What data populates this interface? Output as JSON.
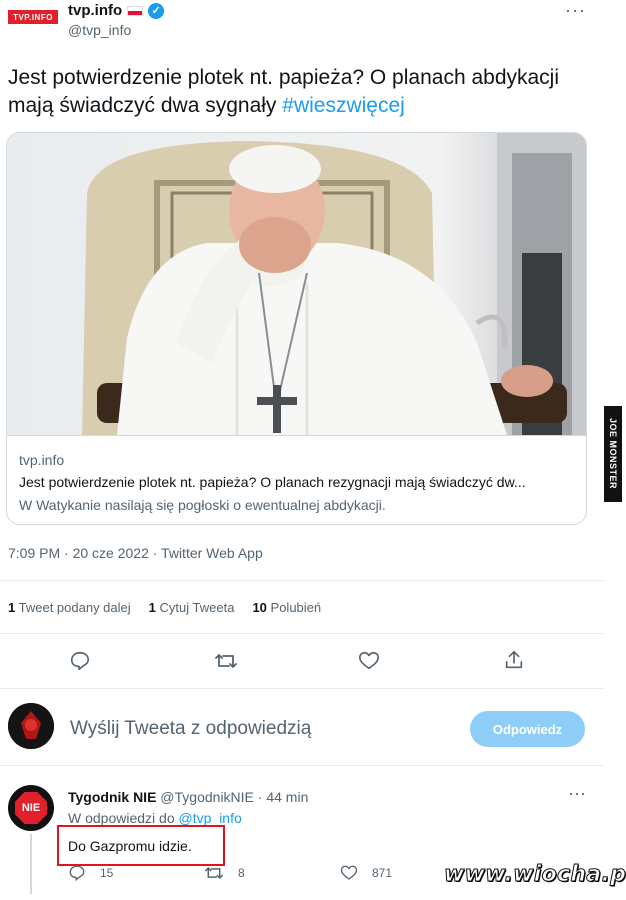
{
  "tweet": {
    "logo_text": "TVP.INFO",
    "author_name": "tvp.info",
    "author_handle": "@tvp_info",
    "more_label": "···",
    "text": "Jest potwierdzenie plotek nt. papieża? O planach abdykacji mają świadczyć dwa sygnały ",
    "hashtag": "#wieszwięcej",
    "card": {
      "domain": "tvp.info",
      "title": "Jest potwierdzenie plotek nt. papieża? O planach rezygnacji mają świadczyć dw...",
      "description": "W Watykanie nasilają się pogłoski o ewentualnej abdykacji."
    },
    "timestamp": "7:09 PM · 20 cze 2022 · Twitter Web App",
    "stats": {
      "retweets_count": "1",
      "retweets_label": "Tweet podany dalej",
      "quotes_count": "1",
      "quotes_label": "Cytuj Tweeta",
      "likes_count": "10",
      "likes_label": "Polubień"
    }
  },
  "compose": {
    "placeholder": "Wyślij Tweeta z odpowiedzią",
    "button_label": "Odpowiedz"
  },
  "reply": {
    "avatar_text": "NIE",
    "name": "Tygodnik NIE",
    "handle_time": " @TygodnikNIE · 44 min",
    "replying_to_prefix": "W odpowiedzi do ",
    "replying_to_mention": "@tvp_info",
    "text": "Do Gazpromu idzie.",
    "more_label": "···",
    "reply_count": "15",
    "retweet_count": "8",
    "like_count": "871"
  },
  "watermarks": {
    "side": "JOE MONSTER",
    "bottom": "www.wiocha.pl"
  },
  "icons": {
    "verified": "verified-badge-icon",
    "reply": "reply-icon",
    "retweet": "retweet-icon",
    "like": "heart-icon",
    "share": "share-icon"
  },
  "colors": {
    "accent": "#1d9bf0",
    "button_disabled": "#8ecdf8",
    "highlight_border": "#e0141e",
    "secondary_text": "#536471"
  }
}
